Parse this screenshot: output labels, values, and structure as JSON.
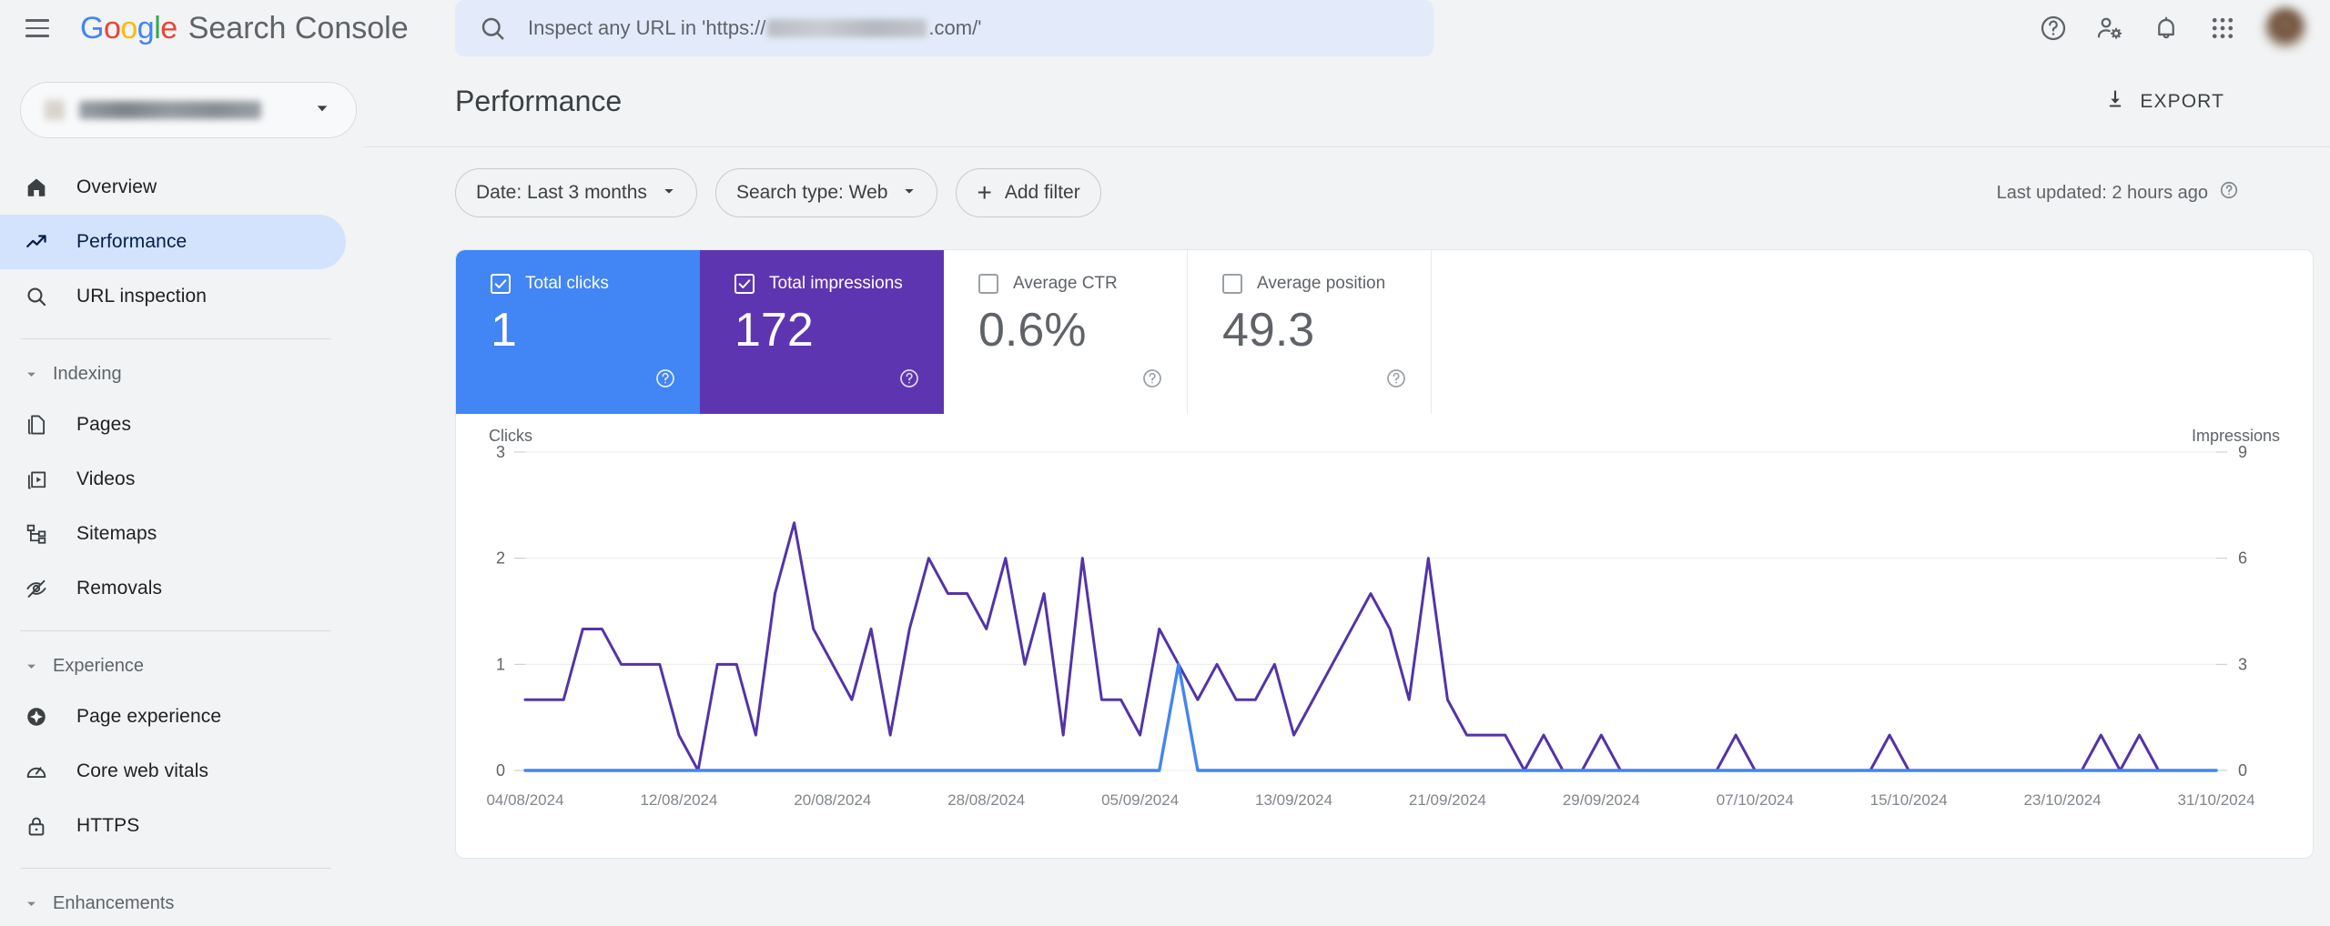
{
  "header": {
    "menu_icon": "hamburger-menu-icon",
    "logo_google": [
      "G",
      "o",
      "o",
      "g",
      "l",
      "e"
    ],
    "logo_product": "Search Console",
    "search": {
      "icon": "search-icon",
      "placeholder_prefix": "Inspect any URL in 'https://",
      "placeholder_suffix": ".com/'",
      "value": ""
    },
    "actions": [
      {
        "name": "help-icon",
        "label": "Help"
      },
      {
        "name": "user-settings-icon",
        "label": "Settings"
      },
      {
        "name": "notifications-bell-icon",
        "label": "Notifications"
      },
      {
        "name": "apps-grid-icon",
        "label": "Google apps"
      },
      {
        "name": "avatar",
        "label": "Account"
      }
    ]
  },
  "sidebar": {
    "property_selector": {
      "label": "",
      "caret": "chevron-down-icon"
    },
    "items": [
      {
        "label": "Overview",
        "icon": "home-icon",
        "active": false
      },
      {
        "label": "Performance",
        "icon": "trending-up-icon",
        "active": true
      },
      {
        "label": "URL inspection",
        "icon": "search-icon",
        "active": false
      }
    ],
    "groups": [
      {
        "label": "Indexing",
        "caret": "chevron-down-icon",
        "items": [
          {
            "label": "Pages",
            "icon": "pages-icon"
          },
          {
            "label": "Videos",
            "icon": "video-icon"
          },
          {
            "label": "Sitemaps",
            "icon": "sitemap-icon"
          },
          {
            "label": "Removals",
            "icon": "eye-off-icon"
          }
        ]
      },
      {
        "label": "Experience",
        "caret": "chevron-down-icon",
        "items": [
          {
            "label": "Page experience",
            "icon": "page-experience-icon"
          },
          {
            "label": "Core web vitals",
            "icon": "speedometer-icon"
          },
          {
            "label": "HTTPS",
            "icon": "lock-icon"
          }
        ]
      },
      {
        "label": "Enhancements",
        "caret": "chevron-down-icon",
        "items": []
      }
    ]
  },
  "main": {
    "page_title": "Performance",
    "export": {
      "label": "EXPORT",
      "icon": "download-icon"
    },
    "filters": [
      {
        "name": "date-filter",
        "label": "Date: Last 3 months",
        "caret": "chevron-down-icon"
      },
      {
        "name": "search-type-filter",
        "label": "Search type: Web",
        "caret": "chevron-down-icon"
      },
      {
        "name": "add-filter",
        "label": "Add filter",
        "icon": "plus-icon"
      }
    ],
    "last_updated": {
      "text": "Last updated: 2 hours ago",
      "icon": "help-icon"
    },
    "metrics": [
      {
        "name": "total-clicks",
        "label": "Total clicks",
        "value": "1",
        "checked": true,
        "state": "sel-clicks",
        "color": "#4285f4"
      },
      {
        "name": "total-impressions",
        "label": "Total impressions",
        "value": "172",
        "checked": true,
        "state": "sel-impr",
        "color": "#5e35b1"
      },
      {
        "name": "average-ctr",
        "label": "Average CTR",
        "value": "0.6%",
        "checked": false,
        "state": "unsel",
        "color": "#ffffff"
      },
      {
        "name": "average-position",
        "label": "Average position",
        "value": "49.3",
        "checked": false,
        "state": "unsel",
        "color": "#ffffff"
      }
    ]
  },
  "chart_data": {
    "type": "line",
    "title": "",
    "xlabel": "",
    "grid": true,
    "legend_position": "none",
    "left_axis": {
      "label": "Clicks",
      "ticks": [
        0,
        1,
        2,
        3
      ],
      "ylim": [
        0,
        3
      ]
    },
    "right_axis": {
      "label": "Impressions",
      "ticks": [
        0,
        3,
        6,
        9
      ],
      "ylim": [
        0,
        9
      ]
    },
    "x_tick_labels": [
      "04/08/2024",
      "12/08/2024",
      "20/08/2024",
      "28/08/2024",
      "05/09/2024",
      "13/09/2024",
      "21/09/2024",
      "29/09/2024",
      "07/10/2024",
      "15/10/2024",
      "23/10/2024",
      "31/10/2024"
    ],
    "x_start": "04/08/2024",
    "x_end": "31/10/2024",
    "n_points": 89,
    "series": [
      {
        "name": "Clicks",
        "axis": "left",
        "color": "#4285f4",
        "values": [
          0,
          0,
          0,
          0,
          0,
          0,
          0,
          0,
          0,
          0,
          0,
          0,
          0,
          0,
          0,
          0,
          0,
          0,
          0,
          0,
          0,
          0,
          0,
          0,
          0,
          0,
          0,
          0,
          0,
          0,
          0,
          0,
          0,
          0,
          1,
          0,
          0,
          0,
          0,
          0,
          0,
          0,
          0,
          0,
          0,
          0,
          0,
          0,
          0,
          0,
          0,
          0,
          0,
          0,
          0,
          0,
          0,
          0,
          0,
          0,
          0,
          0,
          0,
          0,
          0,
          0,
          0,
          0,
          0,
          0,
          0,
          0,
          0,
          0,
          0,
          0,
          0,
          0,
          0,
          0,
          0,
          0,
          0,
          0,
          0,
          0,
          0,
          0,
          0
        ]
      },
      {
        "name": "Impressions",
        "axis": "right",
        "color": "#5433a8",
        "values": [
          2,
          2,
          2,
          4,
          4,
          3,
          3,
          3,
          1,
          0,
          3,
          3,
          1,
          5,
          7,
          4,
          3,
          2,
          4,
          1,
          4,
          6,
          5,
          5,
          4,
          6,
          3,
          5,
          1,
          6,
          2,
          2,
          1,
          4,
          3,
          2,
          3,
          2,
          2,
          3,
          1,
          2,
          3,
          4,
          5,
          4,
          2,
          6,
          2,
          1,
          1,
          1,
          0,
          1,
          0,
          0,
          1,
          0,
          0,
          0,
          0,
          0,
          0,
          1,
          0,
          0,
          0,
          0,
          0,
          0,
          0,
          1,
          0,
          0,
          0,
          0,
          0,
          0,
          0,
          0,
          0,
          0,
          1,
          0,
          1,
          0,
          0,
          0,
          0
        ]
      }
    ]
  }
}
